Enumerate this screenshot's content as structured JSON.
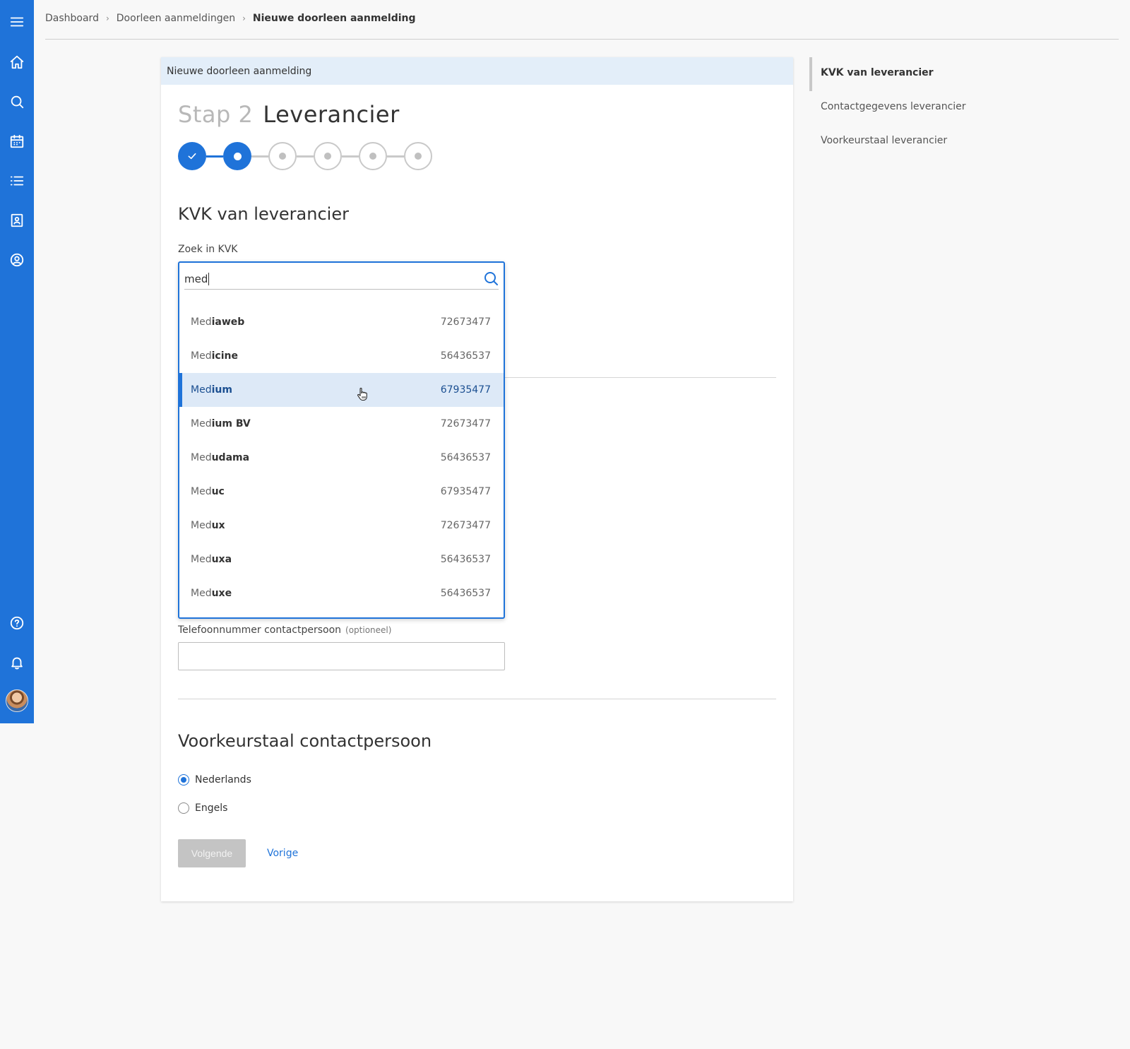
{
  "breadcrumb": {
    "items": [
      "Dashboard",
      "Doorleen aanmeldingen"
    ],
    "current": "Nieuwe doorleen aanmelding"
  },
  "card": {
    "header": "Nieuwe doorleen aanmelding",
    "step_number": "Stap 2",
    "step_name": "Leverancier"
  },
  "stepper": {
    "total": 6,
    "completed": 1,
    "active": 2
  },
  "kvk_section": {
    "title": "KVK van leverancier",
    "search_label": "Zoek in KVK",
    "search_value": "med",
    "results": [
      {
        "match": "Med",
        "rest": "iaweb",
        "kvk": "72673477"
      },
      {
        "match": "Med",
        "rest": "icine",
        "kvk": "56436537"
      },
      {
        "match": "Med",
        "rest": "ium",
        "kvk": "67935477"
      },
      {
        "match": "Med",
        "rest": "ium BV",
        "kvk": "72673477"
      },
      {
        "match": "Med",
        "rest": "udama",
        "kvk": "56436537"
      },
      {
        "match": "Med",
        "rest": "uc",
        "kvk": "67935477"
      },
      {
        "match": "Med",
        "rest": "ux",
        "kvk": "72673477"
      },
      {
        "match": "Med",
        "rest": "uxa",
        "kvk": "56436537"
      },
      {
        "match": "Med",
        "rest": "uxe",
        "kvk": "56436537"
      }
    ],
    "highlighted_index": 2
  },
  "contact": {
    "phone_label": "Telefoonnummer contactpersoon",
    "phone_optional": "(optioneel)",
    "phone_value": ""
  },
  "language_section": {
    "title": "Voorkeurstaal contactpersoon",
    "options": [
      "Nederlands",
      "Engels"
    ],
    "selected": "Nederlands"
  },
  "actions": {
    "next": "Volgende",
    "previous": "Vorige"
  },
  "anchor_nav": {
    "items": [
      "KVK van leverancier",
      "Contactgegevens leverancier",
      "Voorkeurstaal leverancier"
    ],
    "active": "KVK van leverancier"
  },
  "colors": {
    "primary": "#1f73d9",
    "highlight": "#dde9f7",
    "header_bg": "#e3eef9",
    "disabled": "#c4c4c4"
  }
}
